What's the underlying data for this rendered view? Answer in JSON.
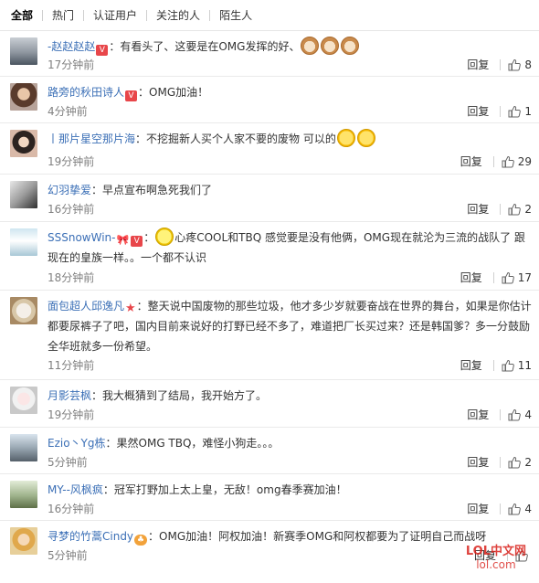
{
  "tabs": [
    {
      "label": "全部",
      "active": true
    },
    {
      "label": "热门"
    },
    {
      "label": "认证用户"
    },
    {
      "label": "关注的人"
    },
    {
      "label": "陌生人"
    }
  ],
  "comments": [
    {
      "user": "-赵赵赵赵",
      "text": "：有看头了、这要是在OMG发挥的好、",
      "time": "17分钟前",
      "reply": "回复",
      "likes": "8"
    },
    {
      "user": "路旁的秋田诗人",
      "text": "：OMG加油！",
      "time": "4分钟前",
      "reply": "回复",
      "likes": "1"
    },
    {
      "user": "丨那片星空那片海",
      "text": "：不挖掘新人买个人家不要的废物 可以的",
      "time": "19分钟前",
      "reply": "回复",
      "likes": "29"
    },
    {
      "user": "幻羽挚爱",
      "text": "：早点宣布啊急死我们了",
      "time": "16分钟前",
      "reply": "回复",
      "likes": "2"
    },
    {
      "user": "SSSnowWin-",
      "text": "心疼COOL和TBQ 感觉要是没有他俩，OMG现在就沦为三流的战队了 跟现在的皇族一样。。一个都不认识",
      "time": "18分钟前",
      "reply": "回复",
      "likes": "17"
    },
    {
      "user": "面包超人邱逸凡",
      "text": "：整天说中国废物的那些垃圾，他才多少岁就要奋战在世界的舞台，如果是你估计都要尿裤子了吧，国内目前来说好的打野已经不多了，难道把厂长买过来？还是韩国爹？多一分鼓励全华班就多一份希望。",
      "time": "11分钟前",
      "reply": "回复",
      "likes": "11"
    },
    {
      "user": "月影芸枫",
      "text": "：我大概猜到了结局，我开始方了。",
      "time": "19分钟前",
      "reply": "回复",
      "likes": "4"
    },
    {
      "user": "Ezio丶Yg栋",
      "text": "：果然OMG TBQ，难怪小狗走。。。",
      "time": "5分钟前",
      "reply": "回复",
      "likes": "2"
    },
    {
      "user": "MY--风枫疯",
      "text": "：冠军打野加上太上皇，无敌！omg春季赛加油！",
      "time": "16分钟前",
      "reply": "回复",
      "likes": "4"
    },
    {
      "user": "寻梦的竹蒿Cindy",
      "text": "：OMG加油！阿权加油！新赛季OMG和阿权都要为了证明自己而战呀",
      "time": "5分钟前",
      "reply": "回复",
      "likes": ""
    }
  ],
  "watermark": {
    "line1": "LOL中文网",
    "line2": "lol.com"
  },
  "colors": {
    "link": "#3b6fb6",
    "meta": "#808080",
    "badge": "#e8464a"
  }
}
